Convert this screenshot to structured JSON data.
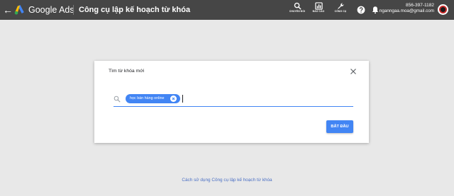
{
  "header": {
    "product_name": "Google Ads",
    "page_title": "Công cụ lập kế hoạch từ khóa",
    "tools": [
      {
        "label": "CHUYỂN ĐỔI",
        "icon": "search-icon"
      },
      {
        "label": "BÁO CÁO",
        "icon": "reports-icon"
      },
      {
        "label": "CÔNG CỤ",
        "icon": "wrench-icon"
      }
    ],
    "account_number": "856-397-1182",
    "account_email": "nganngaa.moa@gmail.com"
  },
  "dialog": {
    "title": "Tìm từ khóa mới",
    "keyword_chip": "học bán hàng online",
    "start_button": "BẮT ĐẦU"
  },
  "footer": {
    "help_link": "Cách sử dụng Công cụ lập kế hoạch từ khóa"
  },
  "colors": {
    "header_bg": "#464646",
    "page_bg": "#e8e8e8",
    "accent": "#4285f4",
    "link": "#4a6fc4"
  }
}
